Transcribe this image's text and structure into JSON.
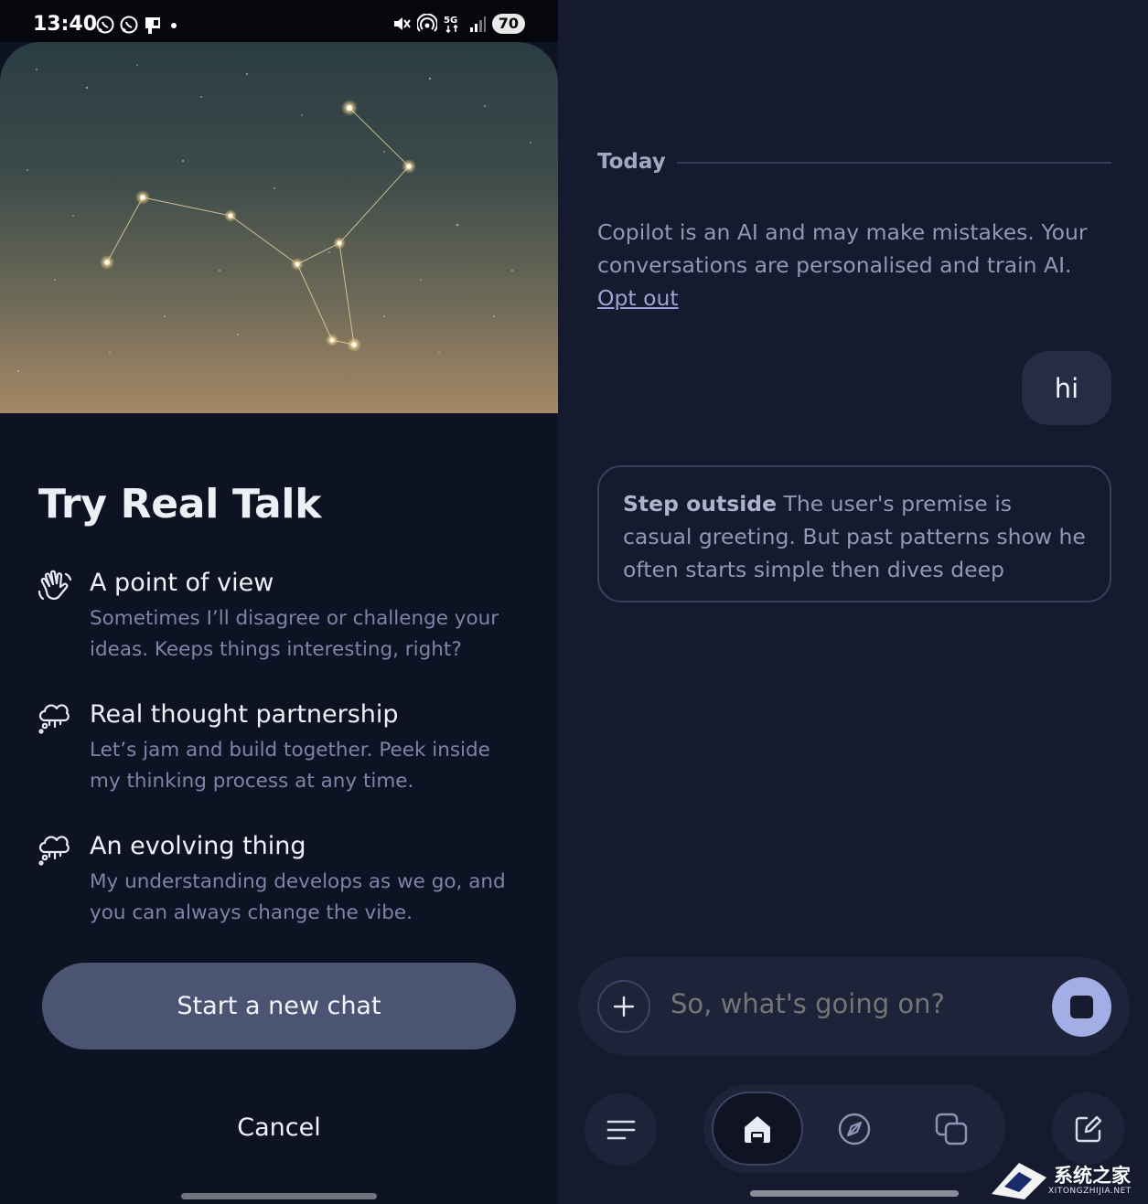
{
  "status_bar": {
    "time": "13:40",
    "battery": "70",
    "left_icons": [
      "whatsapp-icon",
      "whatsapp-icon",
      "cast-icon",
      "dot-icon"
    ],
    "right_icons": [
      "mute-icon",
      "hotspot-icon",
      "5g-icon",
      "signal-icon"
    ]
  },
  "onboarding": {
    "title": "Try Real Talk",
    "features": [
      {
        "icon": "waving-hand-icon",
        "title": "A point of view",
        "description": "Sometimes I’ll disagree or challenge your ideas. Keeps things interesting, right?"
      },
      {
        "icon": "thought-cloud-icon",
        "title": "Real thought partnership",
        "description": "Let’s jam and build together. Peek inside my thinking process at any time."
      },
      {
        "icon": "thought-cloud-icon",
        "title": "An evolving thing",
        "description": "My understanding develops as we go, and you can always change the vibe."
      }
    ],
    "start_button": "Start a new chat",
    "cancel_button": "Cancel"
  },
  "chat": {
    "date_divider": "Today",
    "disclaimer_text": "Copilot is an AI and may make mistakes. Your conversations are personalised and train AI. ",
    "disclaimer_link": "Opt out",
    "user_message": "hi",
    "thought_label": "Step outside",
    "thought_text": " The user's premise is casual greeting. But past patterns show he often starts simple then dives deep",
    "input_placeholder": "So, what's going on?"
  },
  "navigation": {
    "items": [
      "menu-icon",
      "home-icon",
      "discover-icon",
      "pages-icon",
      "compose-icon"
    ],
    "active": "home-icon"
  },
  "watermark": {
    "text": "系统之家",
    "subtext": "XITONGZHIJIA.NET"
  },
  "colors": {
    "accent": "#a3ade6",
    "button": "#4b5473",
    "background": "#0e1323"
  }
}
